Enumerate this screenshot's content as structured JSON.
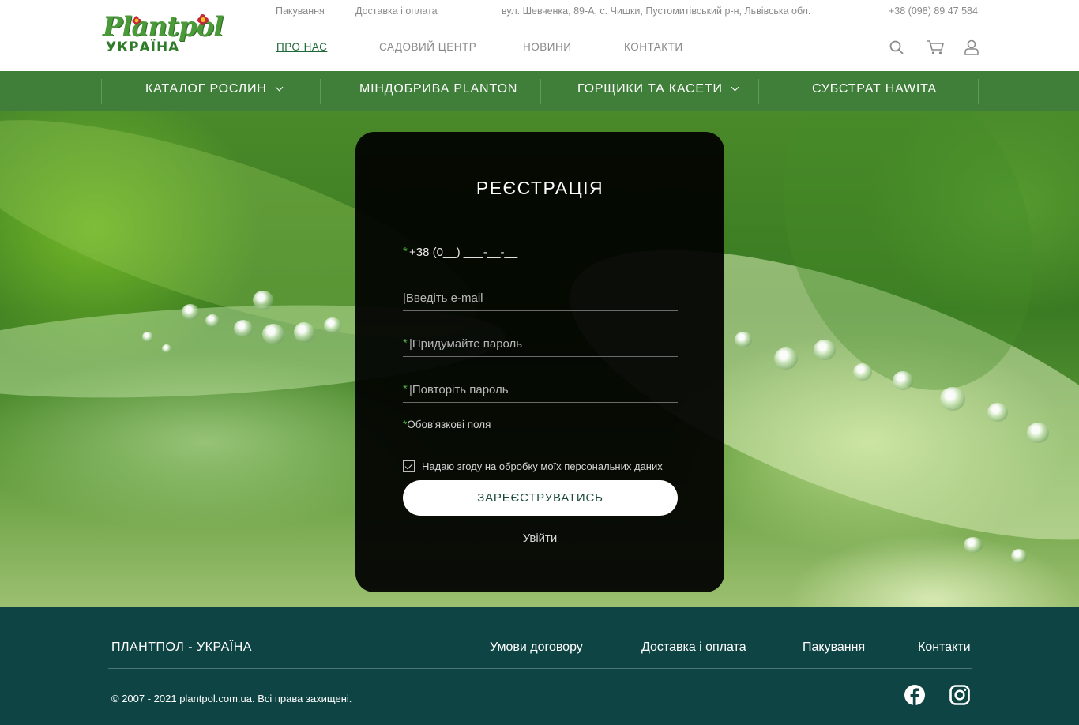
{
  "logo": {
    "brand": "Plantpol",
    "country": "УКРАЇНА"
  },
  "topbar": {
    "packaging": "Пакування",
    "delivery": "Доставка і оплата",
    "address": "вул. Шевченка, 89-А, с. Чишки, Пустомитівський р-н, Львівська обл.",
    "phone": "+38 (098) 89 47 584"
  },
  "nav": {
    "about": "ПРО НАС",
    "garden": "САДОВИЙ ЦЕНТР",
    "news": "НОВИНИ",
    "contacts": "КОНТАКТИ"
  },
  "catnav": {
    "catalog": "КАТАЛОГ РОСЛИН",
    "fertilizers": "МІНДОБРИВА PLANTON",
    "pots": "ГОРЩИКИ ТА КАСЕТИ",
    "substrate": "СУБСТРАТ HAWITA"
  },
  "form": {
    "title": "РЕЄСТРАЦІЯ",
    "phone_placeholder": "+38 (0__) ___-__-__",
    "email_placeholder": "|Введіть e-mail",
    "password_placeholder": "|Придумайте пароль",
    "repeat_placeholder": "|Повторіть пароль",
    "required_star": "*",
    "required_note": "Обов'язкові поля",
    "consent": "Надаю згоду на обробку моїх персональних даних",
    "consent_checked": true,
    "submit": "ЗАРЕЄСТРУВАТИСЬ",
    "login": "Увійти"
  },
  "footer": {
    "brand": "ПЛАНТПОЛ - УКРАЇНА",
    "terms": "Умови договору",
    "delivery": "Доставка і оплата",
    "packaging": "Пакування",
    "contacts": "Контакти",
    "copyright": "© 2007 - 2021 plantpol.com.ua. Всі права захищені.",
    "bg_color": "#0f4444"
  },
  "colors": {
    "green_nav": "#3f7f3a",
    "accent": "#4caa3a"
  }
}
